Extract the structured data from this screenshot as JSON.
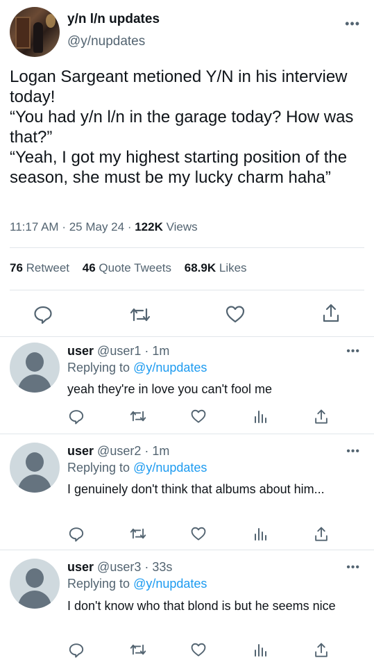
{
  "author": {
    "display_name": "y/n l/n updates",
    "handle": "@y/nupdates",
    "avatar_icon": "profile-photo"
  },
  "tweet": {
    "text": "Logan Sargeant metioned Y/N in his interview today!\n“You had y/n l/n in the garage today? How was that?”\n“Yeah, I got my highest starting position of the season, she must be my lucky charm haha”",
    "time": "11:17 AM",
    "date": "25 May 24",
    "views_count": "122K",
    "views_label": "Views",
    "retweets_count": "76",
    "retweets_label": "Retweet",
    "quotes_count": "46",
    "quotes_label": "Quote Tweets",
    "likes_count": "68.9K",
    "likes_label": "Likes",
    "more_icon": "•••"
  },
  "replies": [
    {
      "name": "user",
      "handle": "@user1",
      "time": "1m",
      "replying_to_label": "Replying to",
      "replying_to": "@y/nupdates",
      "text": "yeah they're in love you can't fool me"
    },
    {
      "name": "user",
      "handle": "@user2",
      "time": "1m",
      "replying_to_label": "Replying to",
      "replying_to": "@y/nupdates",
      "text": "I genuinely don't think that albums about him..."
    },
    {
      "name": "user",
      "handle": "@user3",
      "time": "33s",
      "replying_to_label": "Replying to",
      "replying_to": "@y/nupdates",
      "text": "I don't know who that blond is but he seems nice"
    }
  ],
  "colors": {
    "text": "#0f1419",
    "secondary": "#536471",
    "link": "#1d9bf0",
    "divider": "#e1e6ea"
  }
}
